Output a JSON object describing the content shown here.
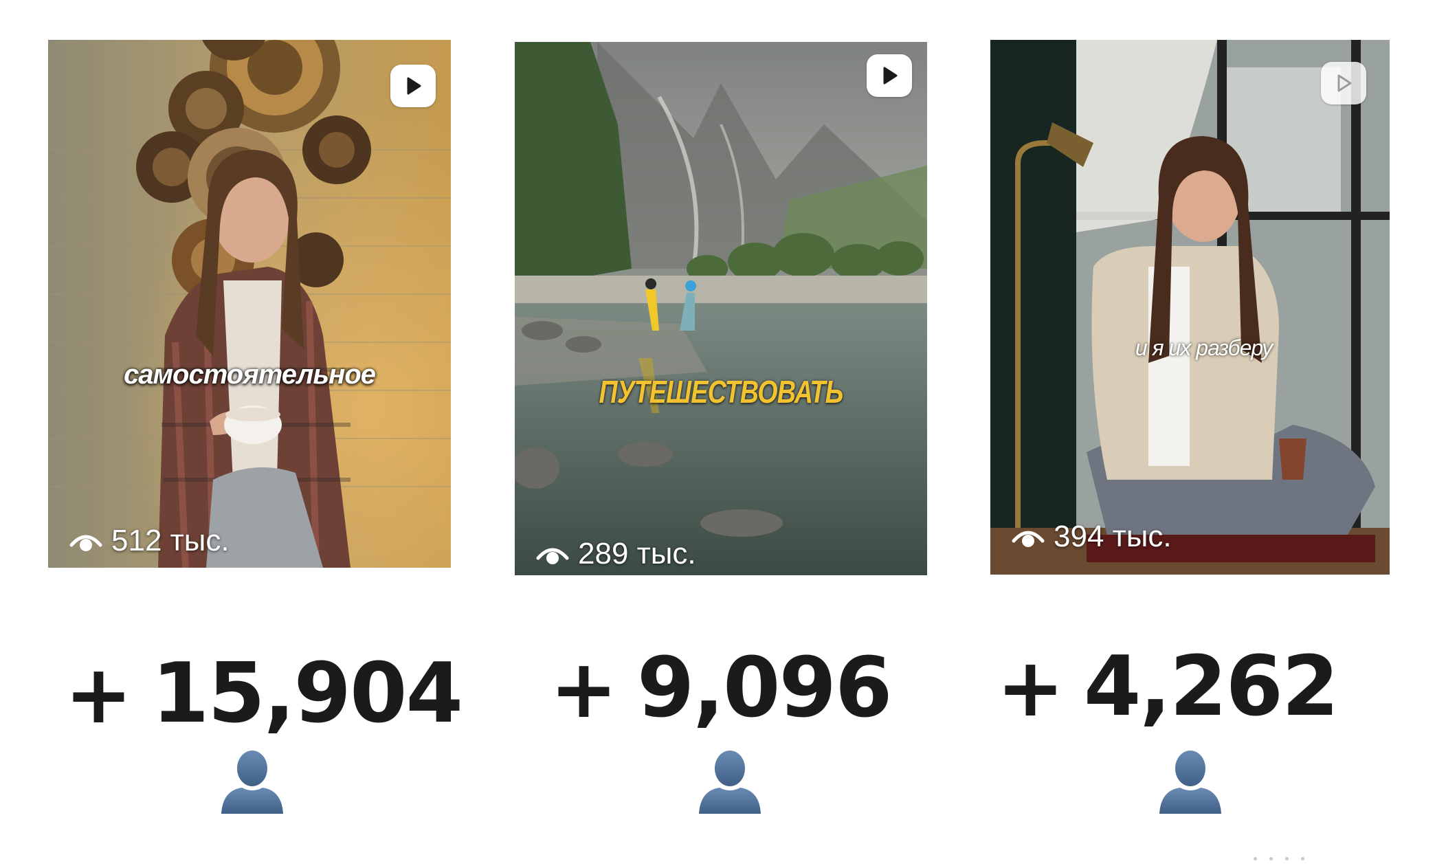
{
  "videos": [
    {
      "overlay_text": "самостоятельное",
      "views": "512 тыс.",
      "subscribers_gained": "15,904",
      "plus": "+"
    },
    {
      "overlay_text": "ПУТЕШЕСТВОВАТЬ",
      "views": "289 тыс.",
      "subscribers_gained": "9,096",
      "plus": "+"
    },
    {
      "overlay_text": "и я их разберу",
      "views": "394 тыс.",
      "subscribers_gained": "4,262",
      "plus": "+"
    }
  ],
  "icons": {
    "play": "play-icon",
    "views": "eye-icon",
    "subscriber": "bust-in-silhouette-icon"
  },
  "colors": {
    "text_dark": "#1b1b1d",
    "overlay_yellow": "#f2c230",
    "person_icon": "#4a6a92"
  }
}
